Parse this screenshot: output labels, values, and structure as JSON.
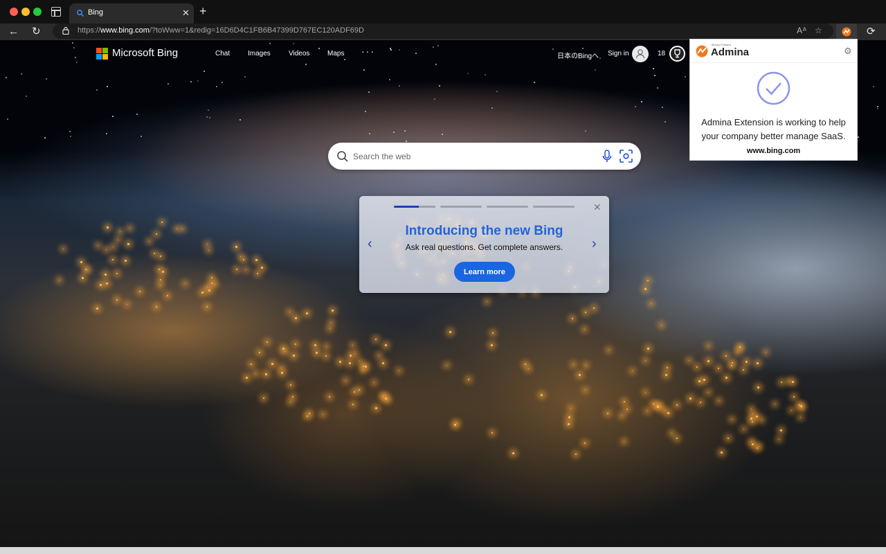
{
  "browser": {
    "tab": {
      "title": "Bing",
      "favicon": "bing-search-icon"
    },
    "address": {
      "url_prefix": "https://",
      "url_host": "www.bing.com",
      "url_rest": "/?toWww=1&redig=16D6D4C1FB6B47399D767EC120ADF69D"
    }
  },
  "bing": {
    "logo_text": "Microsoft Bing",
    "logo_colors": [
      "#f25022",
      "#7fba00",
      "#00a4ef",
      "#ffb900"
    ],
    "nav": [
      "Chat",
      "Images",
      "Videos",
      "Maps"
    ],
    "nav_more": "···",
    "lang_link": "日本のBingへ",
    "signin": "Sign in",
    "rewards_count": "18",
    "search_placeholder": "Search the web",
    "card": {
      "title": "Introducing the new Bing",
      "subtitle": "Ask real questions. Get complete answers.",
      "button": "Learn more"
    }
  },
  "popup": {
    "brand_tag": "Money Forward",
    "brand_name": "Admina",
    "message": "Admina Extension is working to help your company better manage SaaS.",
    "domain": "www.bing.com",
    "accent": "#8a95e6"
  }
}
